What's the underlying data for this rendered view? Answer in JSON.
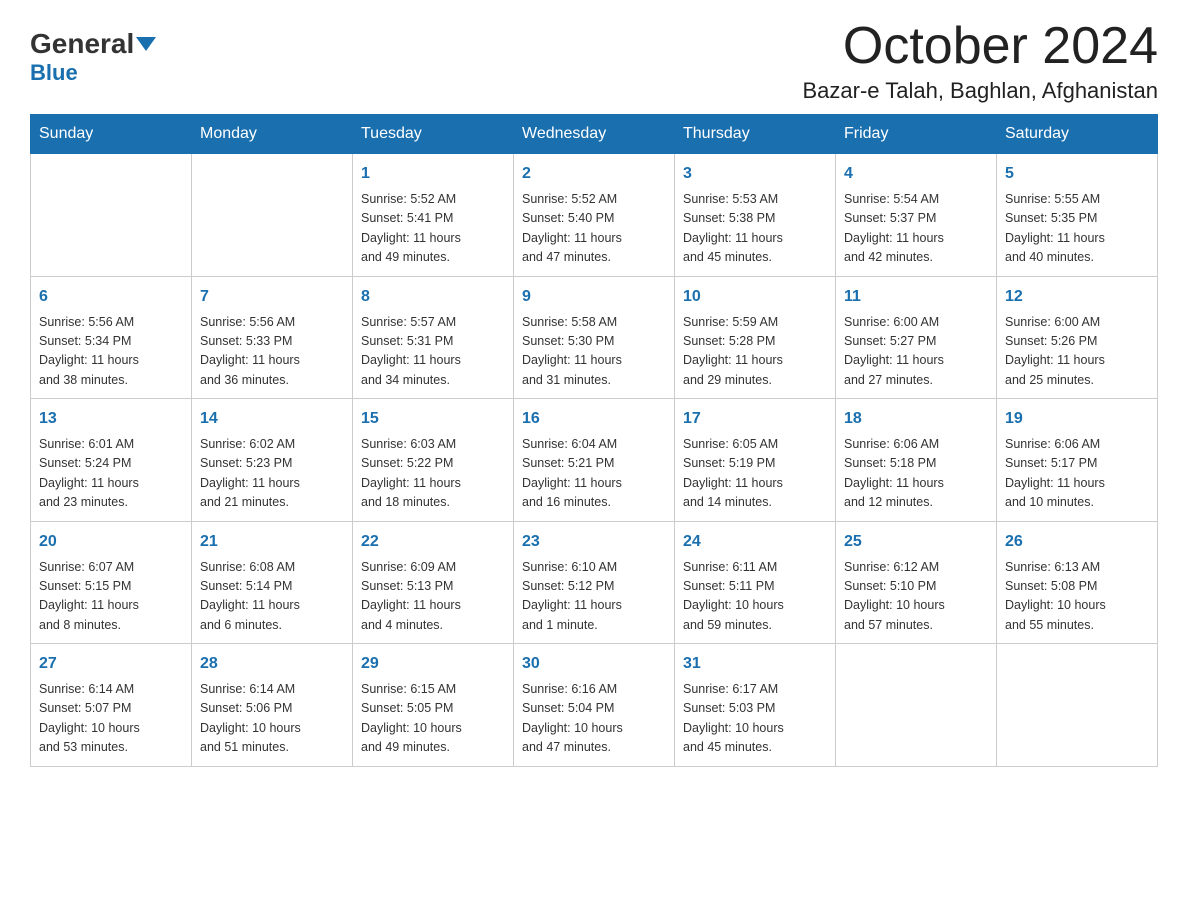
{
  "header": {
    "logo_general": "General",
    "logo_blue": "Blue",
    "month_title": "October 2024",
    "location": "Bazar-e Talah, Baghlan, Afghanistan"
  },
  "weekdays": [
    "Sunday",
    "Monday",
    "Tuesday",
    "Wednesday",
    "Thursday",
    "Friday",
    "Saturday"
  ],
  "weeks": [
    [
      {
        "day": "",
        "info": ""
      },
      {
        "day": "",
        "info": ""
      },
      {
        "day": "1",
        "info": "Sunrise: 5:52 AM\nSunset: 5:41 PM\nDaylight: 11 hours\nand 49 minutes."
      },
      {
        "day": "2",
        "info": "Sunrise: 5:52 AM\nSunset: 5:40 PM\nDaylight: 11 hours\nand 47 minutes."
      },
      {
        "day": "3",
        "info": "Sunrise: 5:53 AM\nSunset: 5:38 PM\nDaylight: 11 hours\nand 45 minutes."
      },
      {
        "day": "4",
        "info": "Sunrise: 5:54 AM\nSunset: 5:37 PM\nDaylight: 11 hours\nand 42 minutes."
      },
      {
        "day": "5",
        "info": "Sunrise: 5:55 AM\nSunset: 5:35 PM\nDaylight: 11 hours\nand 40 minutes."
      }
    ],
    [
      {
        "day": "6",
        "info": "Sunrise: 5:56 AM\nSunset: 5:34 PM\nDaylight: 11 hours\nand 38 minutes."
      },
      {
        "day": "7",
        "info": "Sunrise: 5:56 AM\nSunset: 5:33 PM\nDaylight: 11 hours\nand 36 minutes."
      },
      {
        "day": "8",
        "info": "Sunrise: 5:57 AM\nSunset: 5:31 PM\nDaylight: 11 hours\nand 34 minutes."
      },
      {
        "day": "9",
        "info": "Sunrise: 5:58 AM\nSunset: 5:30 PM\nDaylight: 11 hours\nand 31 minutes."
      },
      {
        "day": "10",
        "info": "Sunrise: 5:59 AM\nSunset: 5:28 PM\nDaylight: 11 hours\nand 29 minutes."
      },
      {
        "day": "11",
        "info": "Sunrise: 6:00 AM\nSunset: 5:27 PM\nDaylight: 11 hours\nand 27 minutes."
      },
      {
        "day": "12",
        "info": "Sunrise: 6:00 AM\nSunset: 5:26 PM\nDaylight: 11 hours\nand 25 minutes."
      }
    ],
    [
      {
        "day": "13",
        "info": "Sunrise: 6:01 AM\nSunset: 5:24 PM\nDaylight: 11 hours\nand 23 minutes."
      },
      {
        "day": "14",
        "info": "Sunrise: 6:02 AM\nSunset: 5:23 PM\nDaylight: 11 hours\nand 21 minutes."
      },
      {
        "day": "15",
        "info": "Sunrise: 6:03 AM\nSunset: 5:22 PM\nDaylight: 11 hours\nand 18 minutes."
      },
      {
        "day": "16",
        "info": "Sunrise: 6:04 AM\nSunset: 5:21 PM\nDaylight: 11 hours\nand 16 minutes."
      },
      {
        "day": "17",
        "info": "Sunrise: 6:05 AM\nSunset: 5:19 PM\nDaylight: 11 hours\nand 14 minutes."
      },
      {
        "day": "18",
        "info": "Sunrise: 6:06 AM\nSunset: 5:18 PM\nDaylight: 11 hours\nand 12 minutes."
      },
      {
        "day": "19",
        "info": "Sunrise: 6:06 AM\nSunset: 5:17 PM\nDaylight: 11 hours\nand 10 minutes."
      }
    ],
    [
      {
        "day": "20",
        "info": "Sunrise: 6:07 AM\nSunset: 5:15 PM\nDaylight: 11 hours\nand 8 minutes."
      },
      {
        "day": "21",
        "info": "Sunrise: 6:08 AM\nSunset: 5:14 PM\nDaylight: 11 hours\nand 6 minutes."
      },
      {
        "day": "22",
        "info": "Sunrise: 6:09 AM\nSunset: 5:13 PM\nDaylight: 11 hours\nand 4 minutes."
      },
      {
        "day": "23",
        "info": "Sunrise: 6:10 AM\nSunset: 5:12 PM\nDaylight: 11 hours\nand 1 minute."
      },
      {
        "day": "24",
        "info": "Sunrise: 6:11 AM\nSunset: 5:11 PM\nDaylight: 10 hours\nand 59 minutes."
      },
      {
        "day": "25",
        "info": "Sunrise: 6:12 AM\nSunset: 5:10 PM\nDaylight: 10 hours\nand 57 minutes."
      },
      {
        "day": "26",
        "info": "Sunrise: 6:13 AM\nSunset: 5:08 PM\nDaylight: 10 hours\nand 55 minutes."
      }
    ],
    [
      {
        "day": "27",
        "info": "Sunrise: 6:14 AM\nSunset: 5:07 PM\nDaylight: 10 hours\nand 53 minutes."
      },
      {
        "day": "28",
        "info": "Sunrise: 6:14 AM\nSunset: 5:06 PM\nDaylight: 10 hours\nand 51 minutes."
      },
      {
        "day": "29",
        "info": "Sunrise: 6:15 AM\nSunset: 5:05 PM\nDaylight: 10 hours\nand 49 minutes."
      },
      {
        "day": "30",
        "info": "Sunrise: 6:16 AM\nSunset: 5:04 PM\nDaylight: 10 hours\nand 47 minutes."
      },
      {
        "day": "31",
        "info": "Sunrise: 6:17 AM\nSunset: 5:03 PM\nDaylight: 10 hours\nand 45 minutes."
      },
      {
        "day": "",
        "info": ""
      },
      {
        "day": "",
        "info": ""
      }
    ]
  ]
}
